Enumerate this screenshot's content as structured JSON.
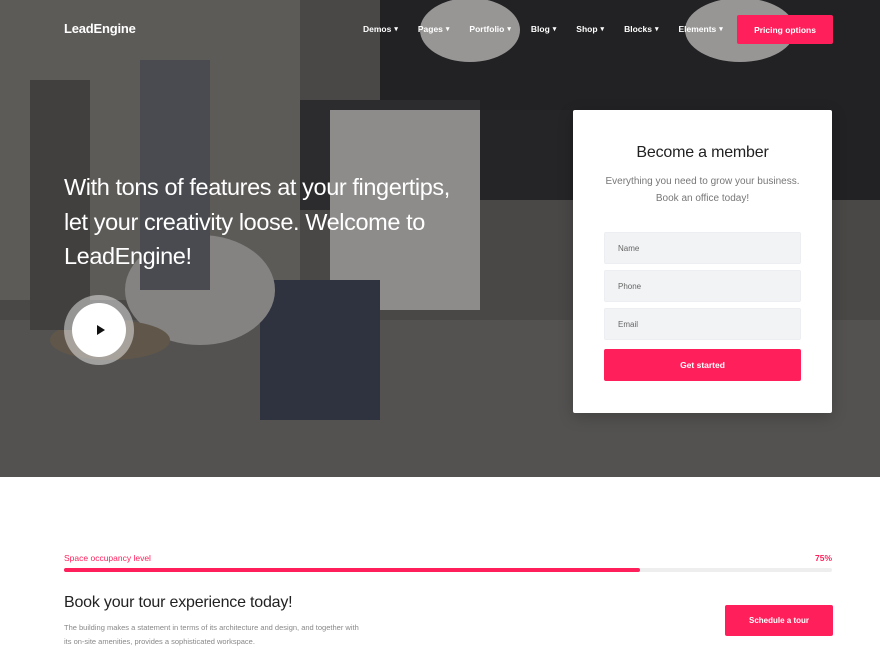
{
  "brand": {
    "name": "LeadEngine",
    "accent": "#ff1f5a"
  },
  "nav": {
    "items": [
      {
        "label": "Demos"
      },
      {
        "label": "Pages"
      },
      {
        "label": "Portfolio"
      },
      {
        "label": "Blog"
      },
      {
        "label": "Shop"
      },
      {
        "label": "Blocks"
      },
      {
        "label": "Elements"
      }
    ],
    "cta_label": "Pricing options",
    "caret_icon": "chevron-down-icon"
  },
  "hero": {
    "title": "With tons of features at your fingertips, let your creativity loose. Welcome to LeadEngine!",
    "play_icon": "play-icon"
  },
  "signup": {
    "title": "Become a member",
    "subtitle": "Everything you need to grow your business. Book an office today!",
    "fields": {
      "name_placeholder": "Name",
      "phone_placeholder": "Phone",
      "email_placeholder": "Email"
    },
    "submit_label": "Get started"
  },
  "occupancy": {
    "label": "Space occupancy level",
    "value_text": "75%",
    "progress": 0.75
  },
  "tour": {
    "title": "Book your tour experience today!",
    "description": "The building makes a statement in terms of its architecture and design, and together with its on-site amenities, provides a sophisticated workspace.",
    "button_label": "Schedule a tour"
  }
}
